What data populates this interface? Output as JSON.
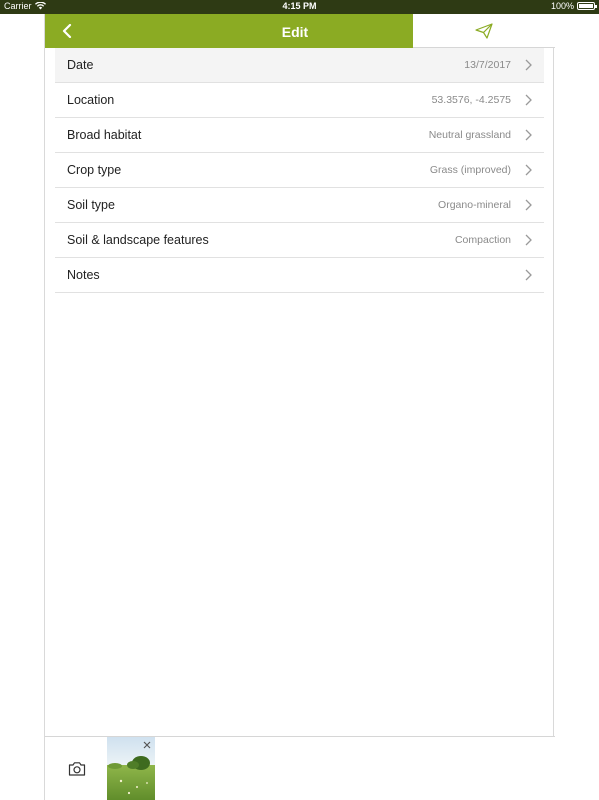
{
  "status_bar": {
    "carrier": "Carrier",
    "time": "4:15 PM",
    "battery": "100%"
  },
  "nav": {
    "title": "Edit",
    "back_icon": "chevron-left-icon",
    "send_icon": "paper-plane-icon",
    "accent_color": "#8bab23"
  },
  "rows": [
    {
      "label": "Date",
      "value": "13/7/2017"
    },
    {
      "label": "Location",
      "value": "53.3576, -4.2575"
    },
    {
      "label": "Broad habitat",
      "value": "Neutral grassland"
    },
    {
      "label": "Crop type",
      "value": "Grass (improved)"
    },
    {
      "label": "Soil type",
      "value": "Organo-mineral"
    },
    {
      "label": "Soil & landscape features",
      "value": "Compaction"
    },
    {
      "label": "Notes",
      "value": ""
    }
  ],
  "footer": {
    "camera_icon": "camera-icon",
    "photo": "grassland-photo-thumbnail"
  }
}
